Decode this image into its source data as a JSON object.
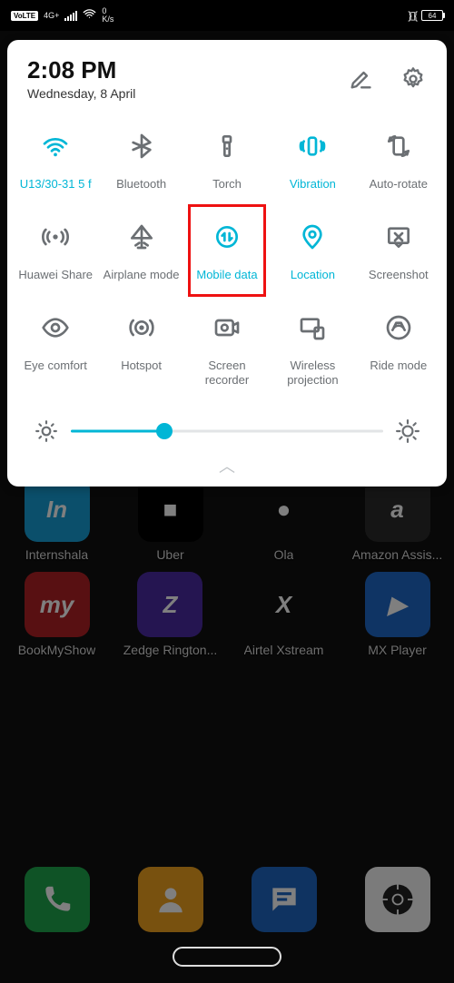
{
  "status": {
    "volte": "VoLTE",
    "net": "4G+",
    "speed_val": "0",
    "speed_unit": "K/s",
    "battery": "64"
  },
  "panel": {
    "time": "2:08 PM",
    "date": "Wednesday, 8 April",
    "brightness_percent": 30,
    "tiles": [
      {
        "id": "wifi",
        "label": "U13/30-31 5 f",
        "active": true,
        "label_active": true
      },
      {
        "id": "bluetooth",
        "label": "Bluetooth",
        "active": false
      },
      {
        "id": "torch",
        "label": "Torch",
        "active": false
      },
      {
        "id": "vibration",
        "label": "Vibration",
        "active": true
      },
      {
        "id": "autorotate",
        "label": "Auto-rotate",
        "active": false
      },
      {
        "id": "huaweishare",
        "label": "Huawei Share",
        "active": false
      },
      {
        "id": "airplane",
        "label": "Airplane mode",
        "active": false
      },
      {
        "id": "mobiledata",
        "label": "Mobile data",
        "active": true,
        "highlighted": true
      },
      {
        "id": "location",
        "label": "Location",
        "active": true
      },
      {
        "id": "screenshot",
        "label": "Screenshot",
        "active": false
      },
      {
        "id": "eyecomfort",
        "label": "Eye comfort",
        "active": false
      },
      {
        "id": "hotspot",
        "label": "Hotspot",
        "active": false
      },
      {
        "id": "screenrec",
        "label": "Screen recorder",
        "active": false
      },
      {
        "id": "wproj",
        "label": "Wireless projection",
        "active": false
      },
      {
        "id": "ridemode",
        "label": "Ride mode",
        "active": false
      }
    ]
  },
  "home": {
    "row1": [
      {
        "name": "Internshala",
        "bg": "#179fd6",
        "glyph": "In"
      },
      {
        "name": "Uber",
        "bg": "#000",
        "glyph": "■"
      },
      {
        "name": "Ola",
        "bg": "#111",
        "glyph": "●"
      },
      {
        "name": "Amazon Assis...",
        "bg": "#2b2b2b",
        "glyph": "a"
      }
    ],
    "row2": [
      {
        "name": "BookMyShow",
        "bg": "#b02125",
        "glyph": "my"
      },
      {
        "name": "Zedge Rington...",
        "bg": "#4a2aa3",
        "glyph": "Z"
      },
      {
        "name": "Airtel Xstream",
        "bg": "#111",
        "glyph": "X"
      },
      {
        "name": "MX Player",
        "bg": "#1f69c8",
        "glyph": "▶"
      }
    ],
    "dock": [
      {
        "name": "",
        "bg": "#1fa74d",
        "glyph": "phone"
      },
      {
        "name": "",
        "bg": "#f0a21e",
        "glyph": "contact"
      },
      {
        "name": "",
        "bg": "#1f66c2",
        "glyph": "msg"
      },
      {
        "name": "",
        "bg": "#f6f6f6",
        "glyph": "gear"
      }
    ]
  }
}
